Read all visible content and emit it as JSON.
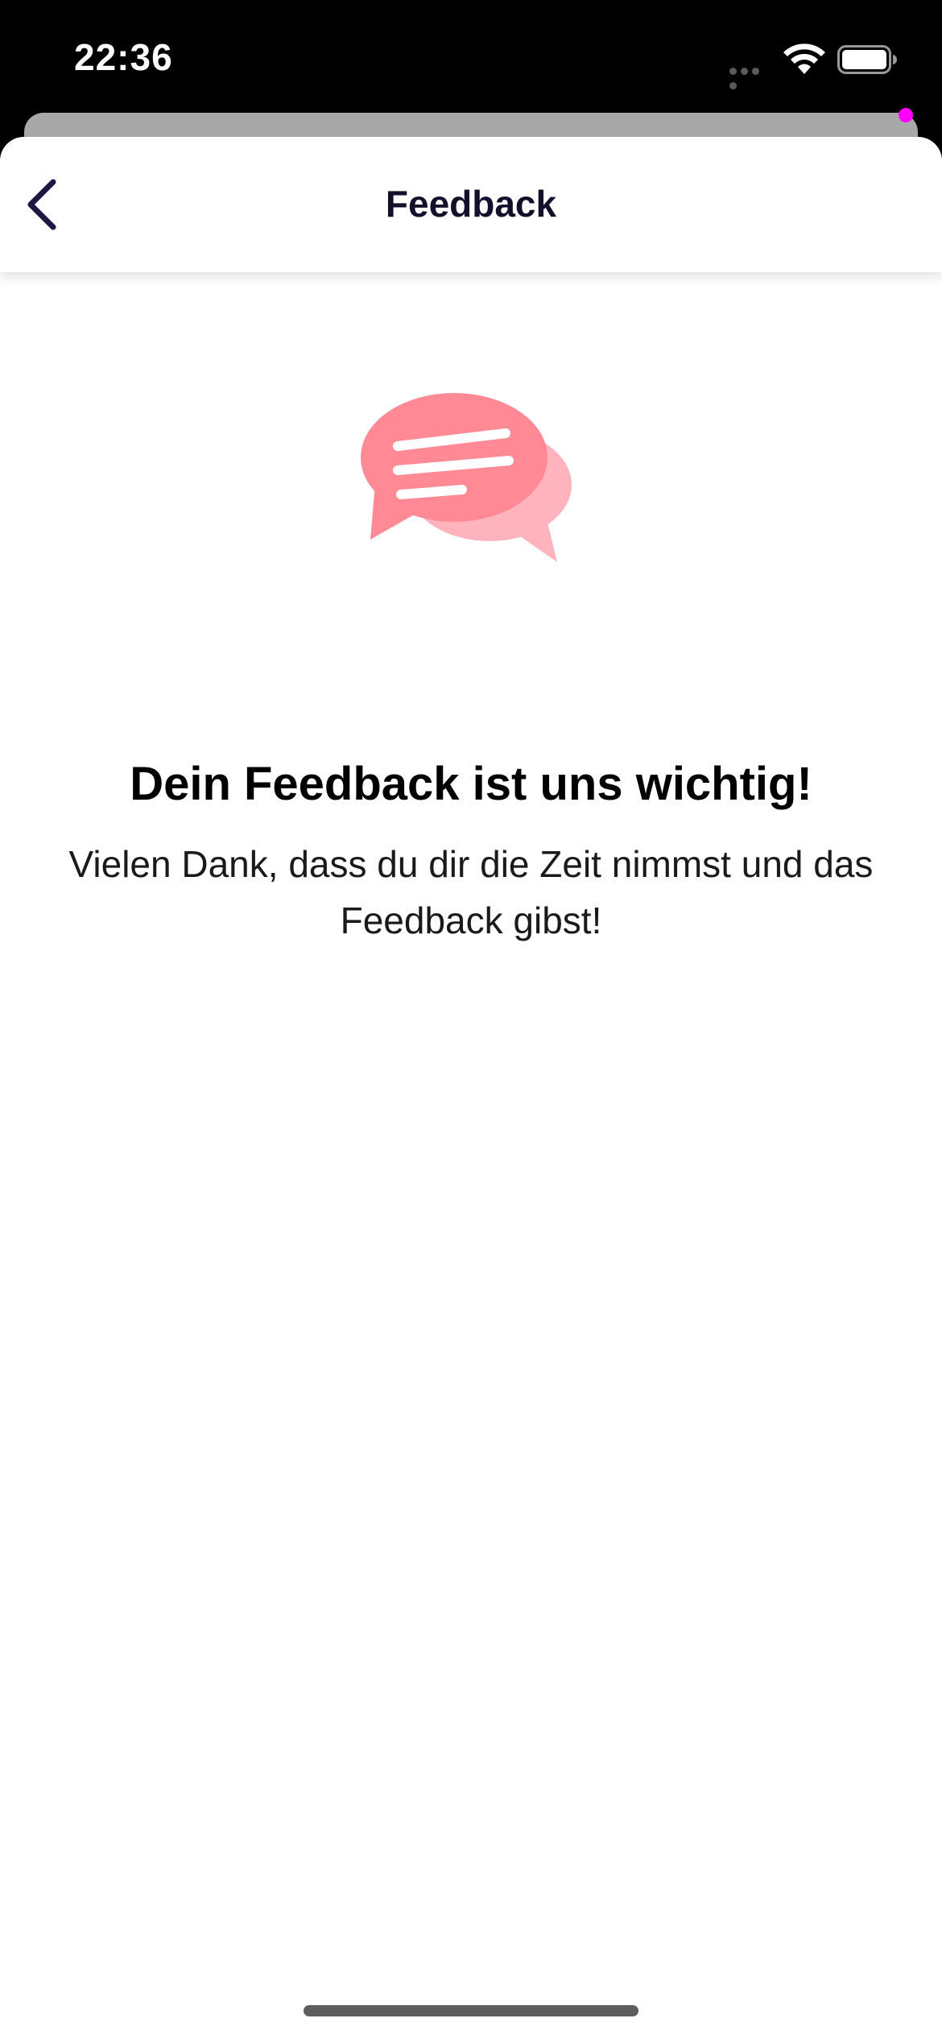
{
  "status_bar": {
    "time": "22:36",
    "icons": [
      "cellular-dots-icon",
      "wifi-icon",
      "battery-icon"
    ]
  },
  "nav": {
    "title": "Feedback",
    "back_icon": "chevron-left-icon"
  },
  "main": {
    "illustration": "chat-bubbles-icon",
    "headline": "Dein Feedback ist uns wichtig!",
    "message": "Vielen Dank, dass du dir die Zeit nimmst und das Feedback gibst!"
  },
  "colors": {
    "accent_pink": "#ff8a96",
    "accent_pink_light": "#ffb3bd",
    "nav_text": "#13102b",
    "privacy_dot": "#ff00ff"
  }
}
